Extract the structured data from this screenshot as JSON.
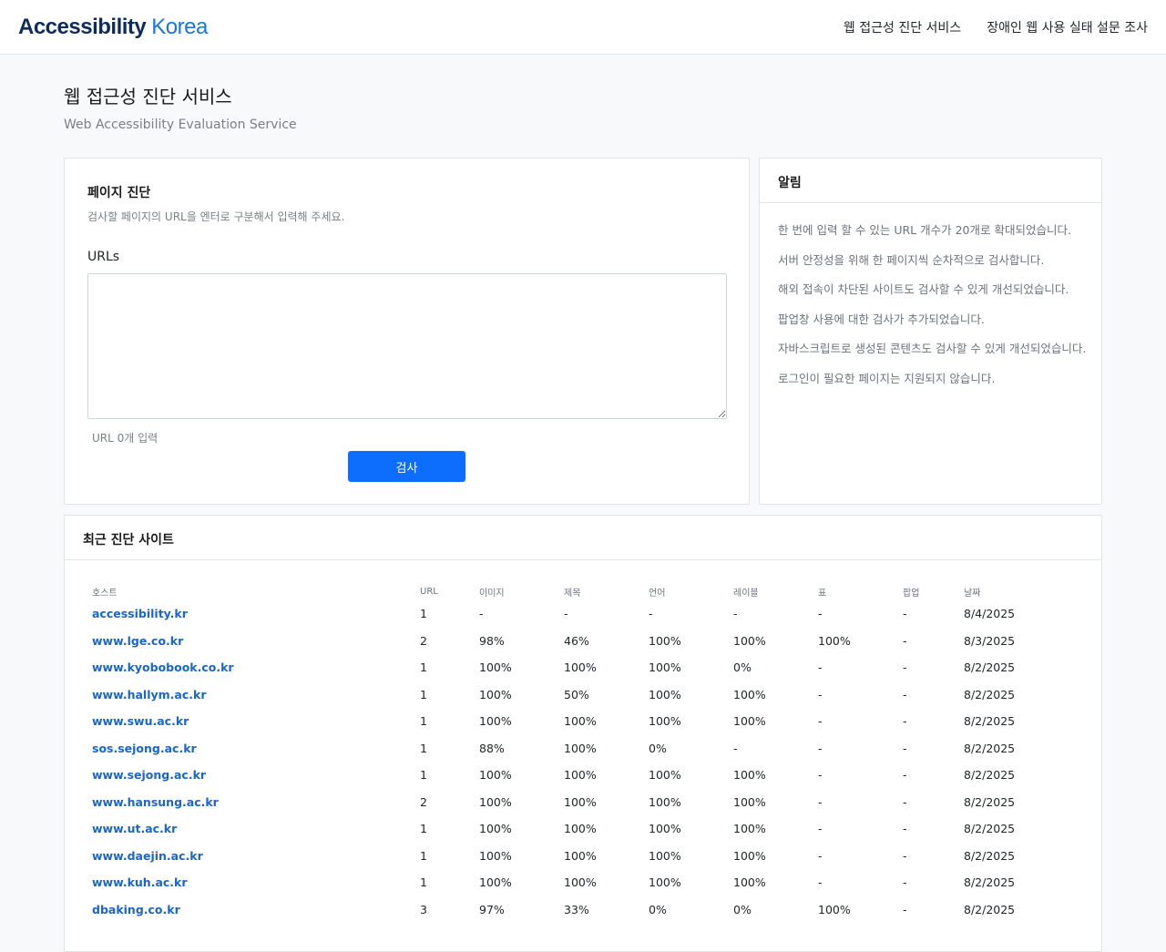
{
  "header": {
    "logo_main": "Accessibility",
    "logo_accent": "Korea",
    "nav": [
      "웹 접근성 진단 서비스",
      "장애인 웹 사용 실태 설문 조사"
    ]
  },
  "page": {
    "title": "웹 접근성 진단 서비스",
    "subtitle": "Web Accessibility Evaluation Service"
  },
  "diagnosis": {
    "title": "페이지 진단",
    "description": "검사할 페이지의 URL을 엔터로 구분해서 입력해 주세요.",
    "urls_label": "URLs",
    "urls_value": "",
    "url_count": "URL 0개 입력",
    "submit_label": "검사"
  },
  "notice": {
    "title": "알림",
    "items": [
      "한 번에 입력 할 수 있는 URL 개수가 20개로 확대되었습니다.",
      "서버 안정성을 위해 한 페이지씩 순차적으로 검사합니다.",
      "해외 접속이 차단된 사이트도 검사할 수 있게 개선되었습니다.",
      "팝업창 사용에 대한 검사가 추가되었습니다.",
      "자바스크립트로 생성된 콘텐츠도 검사할 수 있게 개선되었습니다.",
      "로그인이 필요한 페이지는 지원되지 않습니다."
    ]
  },
  "recent": {
    "title": "최근 진단 사이트",
    "columns": [
      "호스트",
      "URL",
      "이미지",
      "제목",
      "언어",
      "레이블",
      "표",
      "팝업",
      "날짜"
    ],
    "rows": [
      [
        "accessibility.kr",
        "1",
        "-",
        "-",
        "-",
        "-",
        "-",
        "-",
        "8/4/2025"
      ],
      [
        "www.lge.co.kr",
        "2",
        "98%",
        "46%",
        "100%",
        "100%",
        "100%",
        "-",
        "8/3/2025"
      ],
      [
        "www.kyobobook.co.kr",
        "1",
        "100%",
        "100%",
        "100%",
        "0%",
        "-",
        "-",
        "8/2/2025"
      ],
      [
        "www.hallym.ac.kr",
        "1",
        "100%",
        "50%",
        "100%",
        "100%",
        "-",
        "-",
        "8/2/2025"
      ],
      [
        "www.swu.ac.kr",
        "1",
        "100%",
        "100%",
        "100%",
        "100%",
        "-",
        "-",
        "8/2/2025"
      ],
      [
        "sos.sejong.ac.kr",
        "1",
        "88%",
        "100%",
        "0%",
        "-",
        "-",
        "-",
        "8/2/2025"
      ],
      [
        "www.sejong.ac.kr",
        "1",
        "100%",
        "100%",
        "100%",
        "100%",
        "-",
        "-",
        "8/2/2025"
      ],
      [
        "www.hansung.ac.kr",
        "2",
        "100%",
        "100%",
        "100%",
        "100%",
        "-",
        "-",
        "8/2/2025"
      ],
      [
        "www.ut.ac.kr",
        "1",
        "100%",
        "100%",
        "100%",
        "100%",
        "-",
        "-",
        "8/2/2025"
      ],
      [
        "www.daejin.ac.kr",
        "1",
        "100%",
        "100%",
        "100%",
        "100%",
        "-",
        "-",
        "8/2/2025"
      ],
      [
        "www.kuh.ac.kr",
        "1",
        "100%",
        "100%",
        "100%",
        "100%",
        "-",
        "-",
        "8/2/2025"
      ],
      [
        "dbaking.co.kr",
        "3",
        "97%",
        "33%",
        "0%",
        "0%",
        "100%",
        "-",
        "8/2/2025"
      ]
    ]
  },
  "colors": {
    "brand": "#0d2c5c",
    "accent": "#1a73e8",
    "primary_button": "#0d6efd",
    "link": "#1a66c8"
  }
}
